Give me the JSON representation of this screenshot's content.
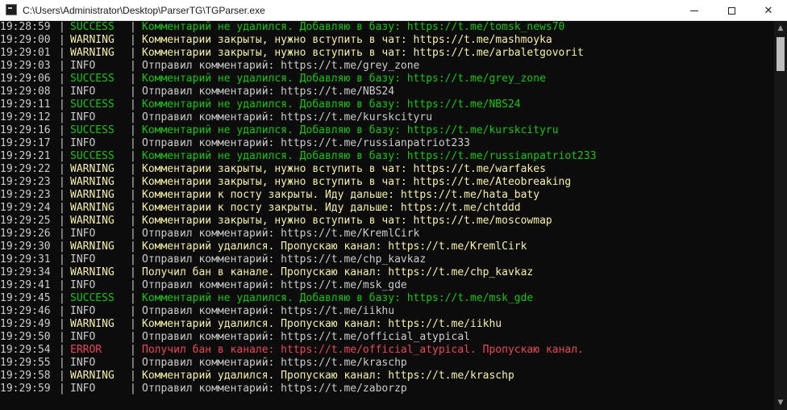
{
  "window": {
    "title": "C:\\Users\\Administrator\\Desktop\\ParserTG\\TGParser.exe",
    "icon": "console-app-icon",
    "controls": {
      "minimize": "minimize-icon",
      "maximize": "maximize-icon",
      "close": "✕"
    }
  },
  "colors": {
    "background": "#0c0c0c",
    "default_text": "#cccccc",
    "SUCCESS": "#16c60c",
    "WARNING": "#f9f1a5",
    "ERROR": "#e74856",
    "INFO": "#cccccc"
  },
  "scrollbar": {
    "up_arrow": "▲",
    "down_arrow": "▼"
  },
  "log": [
    {
      "time": "19:28:59",
      "sep1": "|",
      "level": "SUCCESS",
      "sep2": "|",
      "message": "Комментарий не удалился. Добавляю в базу: https://t.me/tomsk_news70"
    },
    {
      "time": "19:29:00",
      "sep1": "|",
      "level": "WARNING",
      "sep2": "|",
      "message": "Комментарии закрыты, нужно вступить в чат: https://t.me/mashmoyka"
    },
    {
      "time": "19:29:01",
      "sep1": "|",
      "level": "WARNING",
      "sep2": "|",
      "message": "Комментарии закрыты, нужно вступить в чат: https://t.me/arbaletgovorit"
    },
    {
      "time": "19:29:03",
      "sep1": "|",
      "level": "INFO",
      "sep2": "|",
      "message": "Отправил комментарий: https://t.me/grey_zone"
    },
    {
      "time": "19:29:06",
      "sep1": "|",
      "level": "SUCCESS",
      "sep2": "|",
      "message": "Комментарий не удалился. Добавляю в базу: https://t.me/grey_zone"
    },
    {
      "time": "19:29:08",
      "sep1": "|",
      "level": "INFO",
      "sep2": "|",
      "message": "Отправил комментарий: https://t.me/NBS24"
    },
    {
      "time": "19:29:11",
      "sep1": "|",
      "level": "SUCCESS",
      "sep2": "|",
      "message": "Комментарий не удалился. Добавляю в базу: https://t.me/NBS24"
    },
    {
      "time": "19:29:12",
      "sep1": "|",
      "level": "INFO",
      "sep2": "|",
      "message": "Отправил комментарий: https://t.me/kurskcityru"
    },
    {
      "time": "19:29:16",
      "sep1": "|",
      "level": "SUCCESS",
      "sep2": "|",
      "message": "Комментарий не удалился. Добавляю в базу: https://t.me/kurskcityru"
    },
    {
      "time": "19:29:17",
      "sep1": "|",
      "level": "INFO",
      "sep2": "|",
      "message": "Отправил комментарий: https://t.me/russianpatriot233"
    },
    {
      "time": "19:29:21",
      "sep1": "|",
      "level": "SUCCESS",
      "sep2": "|",
      "message": "Комментарий не удалился. Добавляю в базу: https://t.me/russianpatriot233"
    },
    {
      "time": "19:29:22",
      "sep1": "|",
      "level": "WARNING",
      "sep2": "|",
      "message": "Комментарии закрыты, нужно вступить в чат: https://t.me/warfakes"
    },
    {
      "time": "19:29:23",
      "sep1": "|",
      "level": "WARNING",
      "sep2": "|",
      "message": "Комментарии закрыты, нужно вступить в чат: https://t.me/Ateobreaking"
    },
    {
      "time": "19:29:23",
      "sep1": "|",
      "level": "WARNING",
      "sep2": "|",
      "message": "Комментарии к посту закрыты. Иду дальше: https://t.me/hata_baty"
    },
    {
      "time": "19:29:24",
      "sep1": "|",
      "level": "WARNING",
      "sep2": "|",
      "message": "Комментарии к посту закрыты. Иду дальше: https://t.me/chtddd"
    },
    {
      "time": "19:29:25",
      "sep1": "|",
      "level": "WARNING",
      "sep2": "|",
      "message": "Комментарии закрыты, нужно вступить в чат: https://t.me/moscowmap"
    },
    {
      "time": "19:29:26",
      "sep1": "|",
      "level": "INFO",
      "sep2": "|",
      "message": "Отправил комментарий: https://t.me/KremlCirk"
    },
    {
      "time": "19:29:30",
      "sep1": "|",
      "level": "WARNING",
      "sep2": "|",
      "message": "Комментарий удалился. Пропускаю канал: https://t.me/KremlCirk"
    },
    {
      "time": "19:29:31",
      "sep1": "|",
      "level": "INFO",
      "sep2": "|",
      "message": "Отправил комментарий: https://t.me/chp_kavkaz"
    },
    {
      "time": "19:29:34",
      "sep1": "|",
      "level": "WARNING",
      "sep2": "|",
      "message": "Получил бан в канале. Пропускаю канал: https://t.me/chp_kavkaz"
    },
    {
      "time": "19:29:41",
      "sep1": "|",
      "level": "INFO",
      "sep2": "|",
      "message": "Отправил комментарий: https://t.me/msk_gde"
    },
    {
      "time": "19:29:45",
      "sep1": "|",
      "level": "SUCCESS",
      "sep2": "|",
      "message": "Комментарий не удалился. Добавляю в базу: https://t.me/msk_gde"
    },
    {
      "time": "19:29:46",
      "sep1": "|",
      "level": "INFO",
      "sep2": "|",
      "message": "Отправил комментарий: https://t.me/iikhu"
    },
    {
      "time": "19:29:49",
      "sep1": "|",
      "level": "WARNING",
      "sep2": "|",
      "message": "Комментарий удалился. Пропускаю канал: https://t.me/iikhu"
    },
    {
      "time": "19:29:50",
      "sep1": "|",
      "level": "INFO",
      "sep2": "|",
      "message": "Отправил комментарий: https://t.me/official_atypical"
    },
    {
      "time": "19:29:54",
      "sep1": "|",
      "level": "ERROR",
      "sep2": "|",
      "message": "Получил бан в канале: https://t.me/official_atypical. Пропускаю канал."
    },
    {
      "time": "19:29:55",
      "sep1": "|",
      "level": "INFO",
      "sep2": "|",
      "message": "Отправил комментарий: https://t.me/kraschp"
    },
    {
      "time": "19:29:58",
      "sep1": "|",
      "level": "WARNING",
      "sep2": "|",
      "message": "Комментарий удалился. Пропускаю канал: https://t.me/kraschp"
    },
    {
      "time": "19:29:59",
      "sep1": "|",
      "level": "INFO",
      "sep2": "|",
      "message": "Отправил комментарий: https://t.me/zaborzp"
    }
  ]
}
